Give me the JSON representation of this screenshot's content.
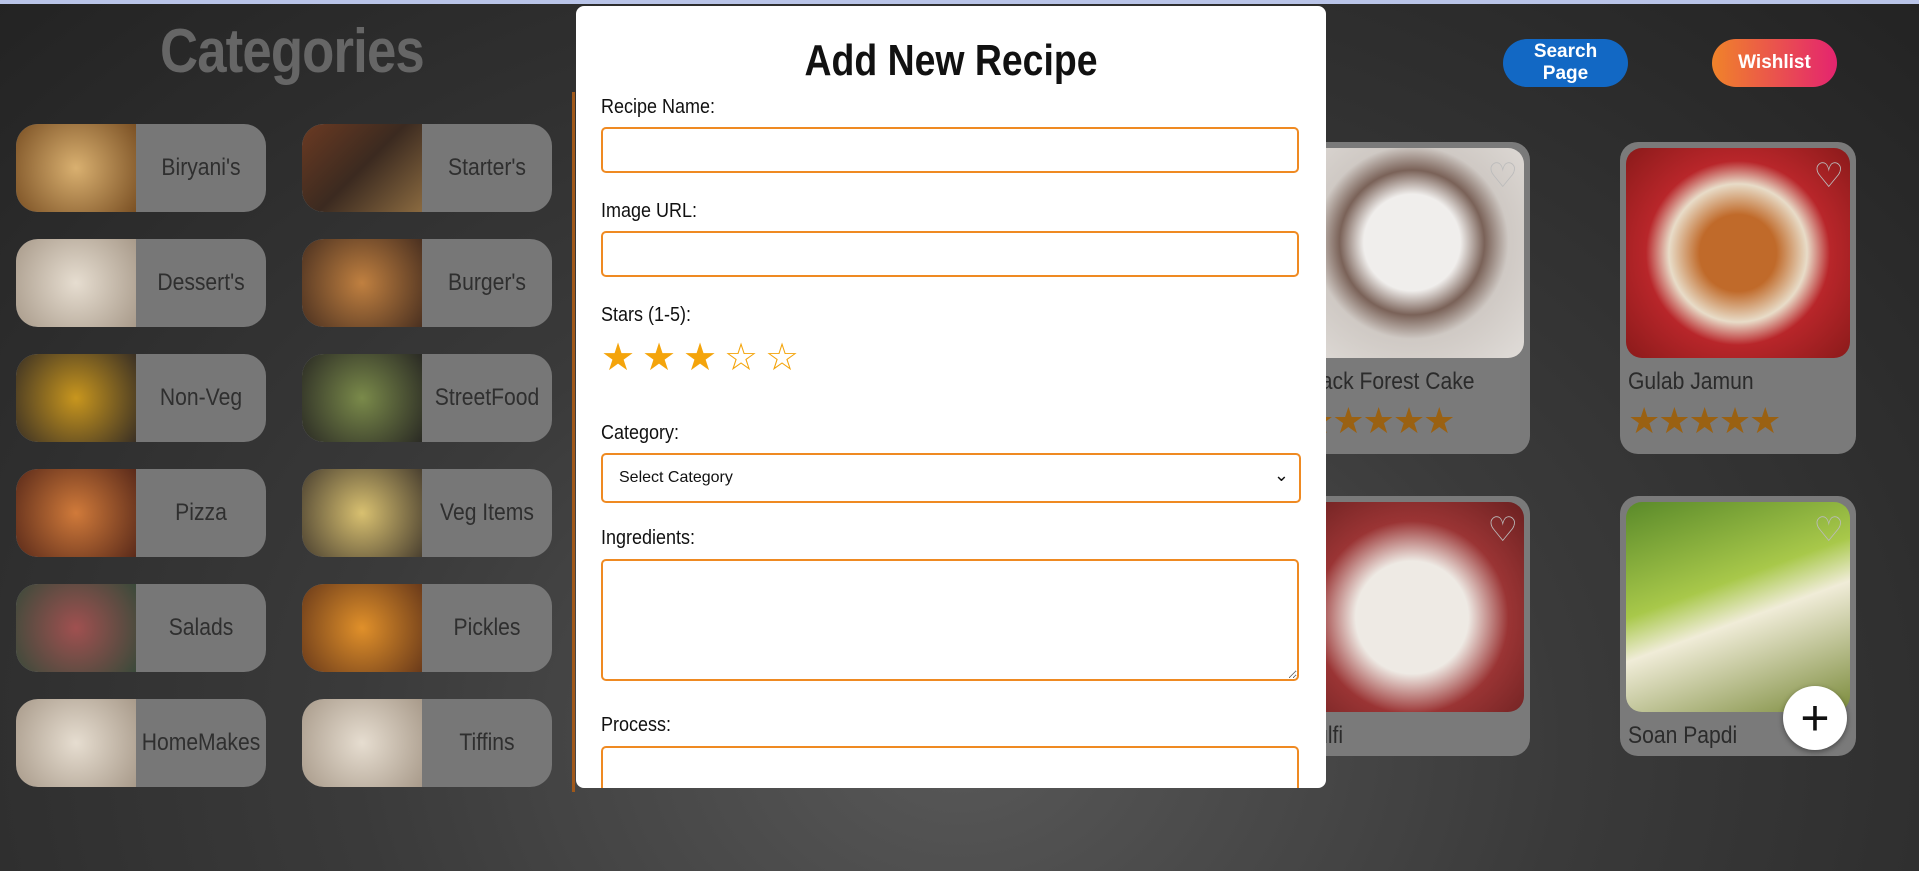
{
  "page": {
    "categories_heading": "Categories",
    "search_button": "Search Page",
    "wishlist_button": "Wishlist",
    "add_button_icon": "plus-icon"
  },
  "categories": [
    {
      "label": "Biryani's",
      "color": "#a87a3b"
    },
    {
      "label": "Starter's",
      "color": "#6b3a22"
    },
    {
      "label": "Dessert's",
      "color": "#c9b8a0"
    },
    {
      "label": "Burger's",
      "color": "#8a5a2e"
    },
    {
      "label": "Non-Veg",
      "color": "#b58b2a"
    },
    {
      "label": "StreetFood",
      "color": "#4f5a3a"
    },
    {
      "label": "Pizza",
      "color": "#b05a2e"
    },
    {
      "label": "Veg Items",
      "color": "#c8a050"
    },
    {
      "label": "Salads",
      "color": "#5f6b4f"
    },
    {
      "label": "Pickles",
      "color": "#c07a2a"
    },
    {
      "label": "HomeMakes",
      "color": "#c9b8a0"
    },
    {
      "label": "Tiffins",
      "color": "#c9b8a0"
    }
  ],
  "recipes": [
    {
      "name": "Black Forest Cake",
      "stars": 5,
      "color": "#cfc9c4"
    },
    {
      "name": "Gulab Jamun",
      "stars": 5,
      "color": "#a34a2a"
    },
    {
      "name": "Kulfi",
      "stars": 0,
      "color": "#b45454"
    },
    {
      "name": "Soan Papdi",
      "stars": 0,
      "color": "#7a9a3a"
    }
  ],
  "modal": {
    "title": "Add New Recipe",
    "recipe_name_label": "Recipe Name:",
    "recipe_name_value": "",
    "image_url_label": "Image URL:",
    "image_url_value": "",
    "stars_label": "Stars (1-5):",
    "stars_selected": 3,
    "stars_max": 5,
    "category_label": "Category:",
    "category_selected": "Select Category",
    "ingredients_label": "Ingredients:",
    "ingredients_value": "",
    "process_label": "Process:",
    "process_value": "",
    "accent_color": "#ef8a22",
    "star_color": "#f4a40b"
  }
}
